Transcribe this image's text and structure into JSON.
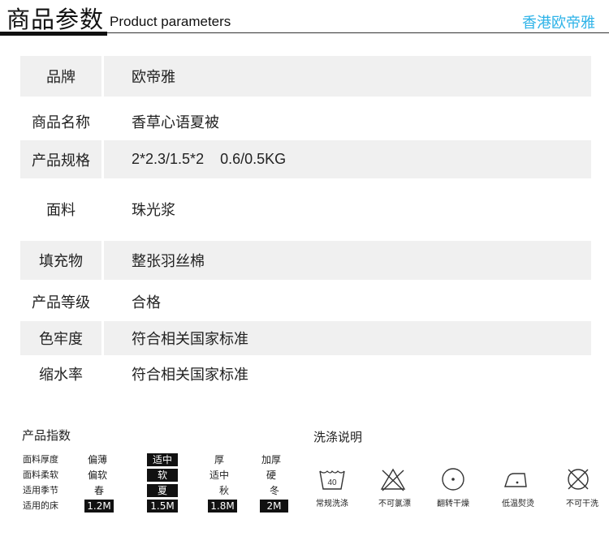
{
  "header": {
    "title_cn": "商品参数",
    "title_en": "Product parameters",
    "brand": "香港欧帝雅",
    "brand_color": "#2eb3e8"
  },
  "params": [
    {
      "label": "品牌",
      "value": "欧帝雅"
    },
    {
      "label": "商品名称",
      "value": "香草心语夏被"
    },
    {
      "label": "产品规格",
      "value": "2*2.3/1.5*2    0.6/0.5KG"
    },
    {
      "label": "面料",
      "value": "珠光浆"
    },
    {
      "label": "填充物",
      "value": "整张羽丝棉"
    },
    {
      "label": "产品等级",
      "value": "合格"
    },
    {
      "label": "色牢度",
      "value": "符合相关国家标准"
    },
    {
      "label": "缩水率",
      "value": "符合相关国家标准"
    }
  ],
  "index": {
    "title": "产品指数",
    "rows": [
      {
        "label": "面料厚度",
        "options": [
          "偏薄",
          "适中",
          "厚",
          "加厚"
        ],
        "selected": 1
      },
      {
        "label": "面料柔软",
        "options": [
          "偏软",
          "软",
          "适中",
          "硬"
        ],
        "selected": 1
      },
      {
        "label": "适用季节",
        "options": [
          "春",
          "夏",
          "秋",
          "冬"
        ],
        "selected": 1
      },
      {
        "label": "适用的床",
        "options": [
          "1.2M",
          "1.5M",
          "1.8M",
          "2M"
        ],
        "selected": [
          0,
          1,
          2,
          3
        ]
      }
    ]
  },
  "care": {
    "title": "洗涤说明",
    "items": [
      {
        "icon": "wash-40-icon",
        "label": "常规洗涤",
        "temp": "40"
      },
      {
        "icon": "no-bleach-icon",
        "label": "不可氯漂"
      },
      {
        "icon": "tumble-dry-icon",
        "label": "翻转干燥"
      },
      {
        "icon": "low-iron-icon",
        "label": "低温熨烫"
      },
      {
        "icon": "no-dry-clean-icon",
        "label": "不可干洗"
      }
    ]
  }
}
